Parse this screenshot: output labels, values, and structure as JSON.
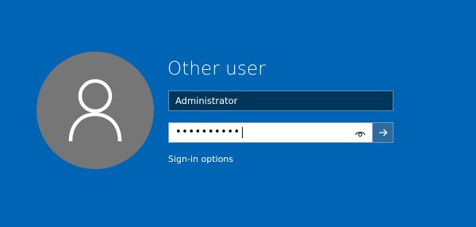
{
  "screen": {
    "background_color": "#0064b5"
  },
  "user": {
    "avatar_icon": "user-icon",
    "avatar_color": "#767676",
    "title": "Other user"
  },
  "username": {
    "value": "Administrator"
  },
  "password": {
    "masked_value": "••••••••••",
    "reveal_icon": "eye-icon"
  },
  "submit": {
    "icon": "arrow-right-icon"
  },
  "sign_in_options": {
    "label": "Sign-in options"
  }
}
